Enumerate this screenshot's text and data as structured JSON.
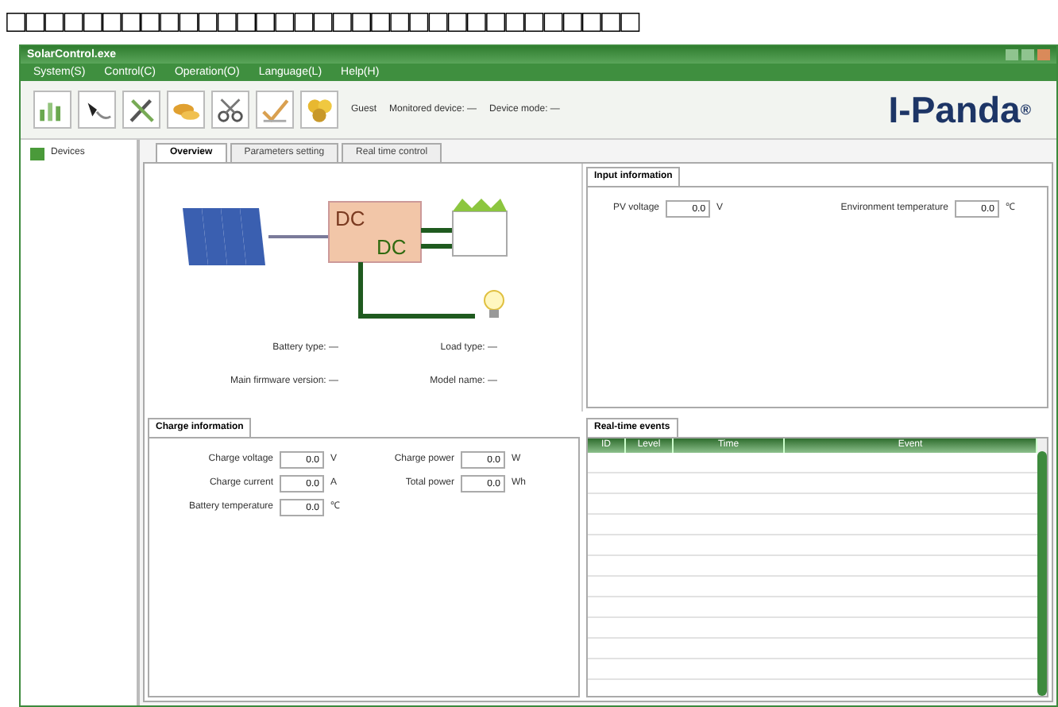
{
  "caption": "□□□□□□□□□□□□□□□□□□□□□□□□□□□□□□□□□",
  "window": {
    "title": "SolarControl.exe"
  },
  "menu": [
    "System(S)",
    "Control(C)",
    "Operation(O)",
    "Language(L)",
    "Help(H)"
  ],
  "toolbar": {
    "status": [
      {
        "label": "Guest"
      },
      {
        "label": "Monitored device: —"
      },
      {
        "label": "Device mode: —"
      }
    ],
    "logo": "I-Panda",
    "logo_mark": "®"
  },
  "sidebar": {
    "items": [
      {
        "label": "Devices",
        "selected": false
      }
    ]
  },
  "tabs": [
    {
      "label": "Overview",
      "selected": true
    },
    {
      "label": "Parameters setting",
      "selected": false
    },
    {
      "label": "Real time control",
      "selected": false
    }
  ],
  "overview": {
    "diagram": {
      "converter_top": "DC",
      "converter_bottom": "DC"
    },
    "fields": [
      "Battery type: —",
      "Load type: —",
      "Main firmware version: —",
      "Model name: —"
    ]
  },
  "input_information": {
    "title": "Input information",
    "fields": [
      {
        "label": "PV voltage",
        "value": "0.0",
        "unit": "V"
      },
      {
        "label": "Environment temperature",
        "value": "0.0",
        "unit": "℃"
      }
    ]
  },
  "charge_information": {
    "title": "Charge information",
    "fields": [
      {
        "label": "Charge voltage",
        "value": "0.0",
        "unit": "V"
      },
      {
        "label": "Charge power",
        "value": "0.0",
        "unit": "W"
      },
      {
        "label": "Charge current",
        "value": "0.0",
        "unit": "A"
      },
      {
        "label": "Total power",
        "value": "0.0",
        "unit": "Wh"
      },
      {
        "label": "Battery temperature",
        "value": "0.0",
        "unit": "℃"
      }
    ]
  },
  "real_time_events": {
    "title": "Real-time events",
    "columns": [
      "ID",
      "Level",
      "Time",
      "Event"
    ]
  }
}
